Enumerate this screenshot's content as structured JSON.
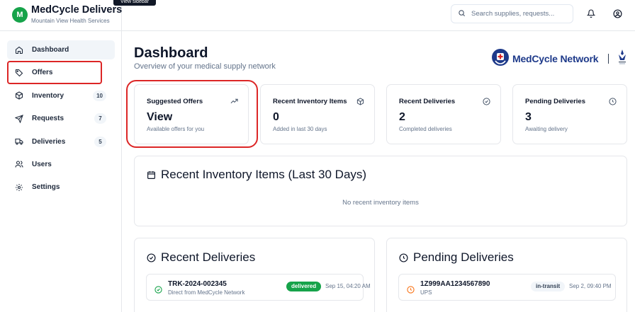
{
  "brand": {
    "initial": "M",
    "title": "MedCycle Delivers",
    "subtitle": "Mountain View Health Services",
    "tooltip": "View sidebar"
  },
  "sidebar": {
    "items": [
      {
        "label": "Dashboard",
        "icon": "home-icon"
      },
      {
        "label": "Offers",
        "icon": "tag-icon"
      },
      {
        "label": "Inventory",
        "icon": "box-icon",
        "badge": "10"
      },
      {
        "label": "Requests",
        "icon": "send-icon",
        "badge": "7"
      },
      {
        "label": "Deliveries",
        "icon": "truck-icon",
        "badge": "5"
      },
      {
        "label": "Users",
        "icon": "users-icon"
      },
      {
        "label": "Settings",
        "icon": "gear-icon"
      }
    ]
  },
  "header": {
    "search_placeholder": "Search supplies, requests..."
  },
  "page": {
    "title": "Dashboard",
    "subtitle": "Overview of your medical supply network",
    "logo_text": "MedCycle Network"
  },
  "stats": [
    {
      "title": "Suggested Offers",
      "value": "View",
      "caption": "Available offers for you",
      "icon": "trending-up-icon"
    },
    {
      "title": "Recent Inventory Items",
      "value": "0",
      "caption": "Added in last 30 days",
      "icon": "box-icon"
    },
    {
      "title": "Recent Deliveries",
      "value": "2",
      "caption": "Completed deliveries",
      "icon": "check-circle-icon"
    },
    {
      "title": "Pending Deliveries",
      "value": "3",
      "caption": "Awaiting delivery",
      "icon": "clock-icon"
    }
  ],
  "inventory_section": {
    "title": "Recent Inventory Items (Last 30 Days)",
    "empty": "No recent inventory items"
  },
  "recent_deliveries": {
    "title": "Recent Deliveries",
    "items": [
      {
        "tracking": "TRK-2024-002345",
        "source": "Direct from MedCycle Network",
        "status": "delivered",
        "time": "Sep 15, 04:20 AM"
      }
    ]
  },
  "pending_deliveries": {
    "title": "Pending Deliveries",
    "items": [
      {
        "tracking": "1Z999AA1234567890",
        "source": "UPS",
        "status": "in-transit",
        "time": "Sep 2, 09:40 PM"
      }
    ]
  },
  "colors": {
    "brand_green": "#16a34a",
    "highlight_red": "#dc2626",
    "logo_blue": "#1e3a8a",
    "pending_orange": "#f97316"
  }
}
